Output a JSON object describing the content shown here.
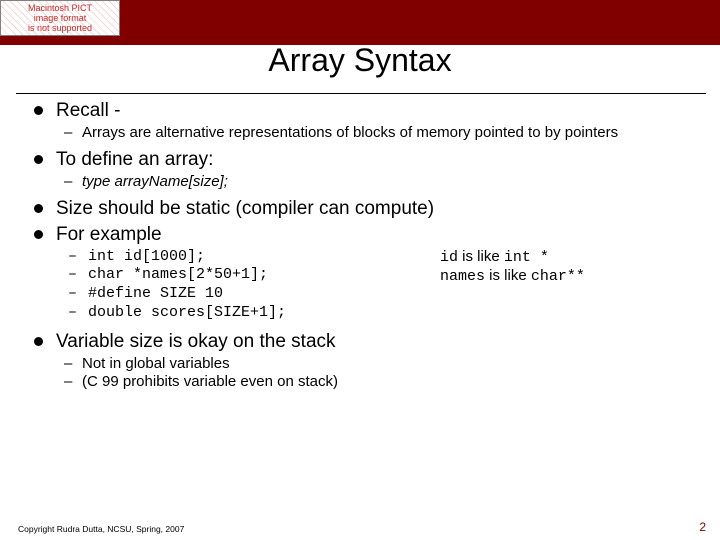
{
  "pict_box": "Macintosh PICT\nimage format\nis not supported",
  "title": "Array Syntax",
  "b1": "Recall -",
  "b1s1": "Arrays are alternative representations of blocks of memory pointed to by pointers",
  "b2": "To define an array:",
  "b2s1_pre": "type array",
  "b2s1_post": "Name[size];",
  "b3": "Size should be static (compiler can compute)",
  "b4": "For example",
  "c1": "int id[1000];",
  "c2": "char *names[2*50+1];",
  "c3": "#define SIZE 10",
  "c4": "double scores[SIZE+1];",
  "aside1_a": "id",
  "aside1_b": " is like ",
  "aside1_c": "int *",
  "aside2_a": "names",
  "aside2_b": " is like ",
  "aside2_c": "char**",
  "b5": "Variable size is okay on the stack",
  "b5s1": "Not in global variables",
  "b5s2": "(C 99 prohibits variable even on stack)",
  "footer": "Copyright Rudra Dutta, NCSU, Spring, 2007",
  "pagenum": "2"
}
